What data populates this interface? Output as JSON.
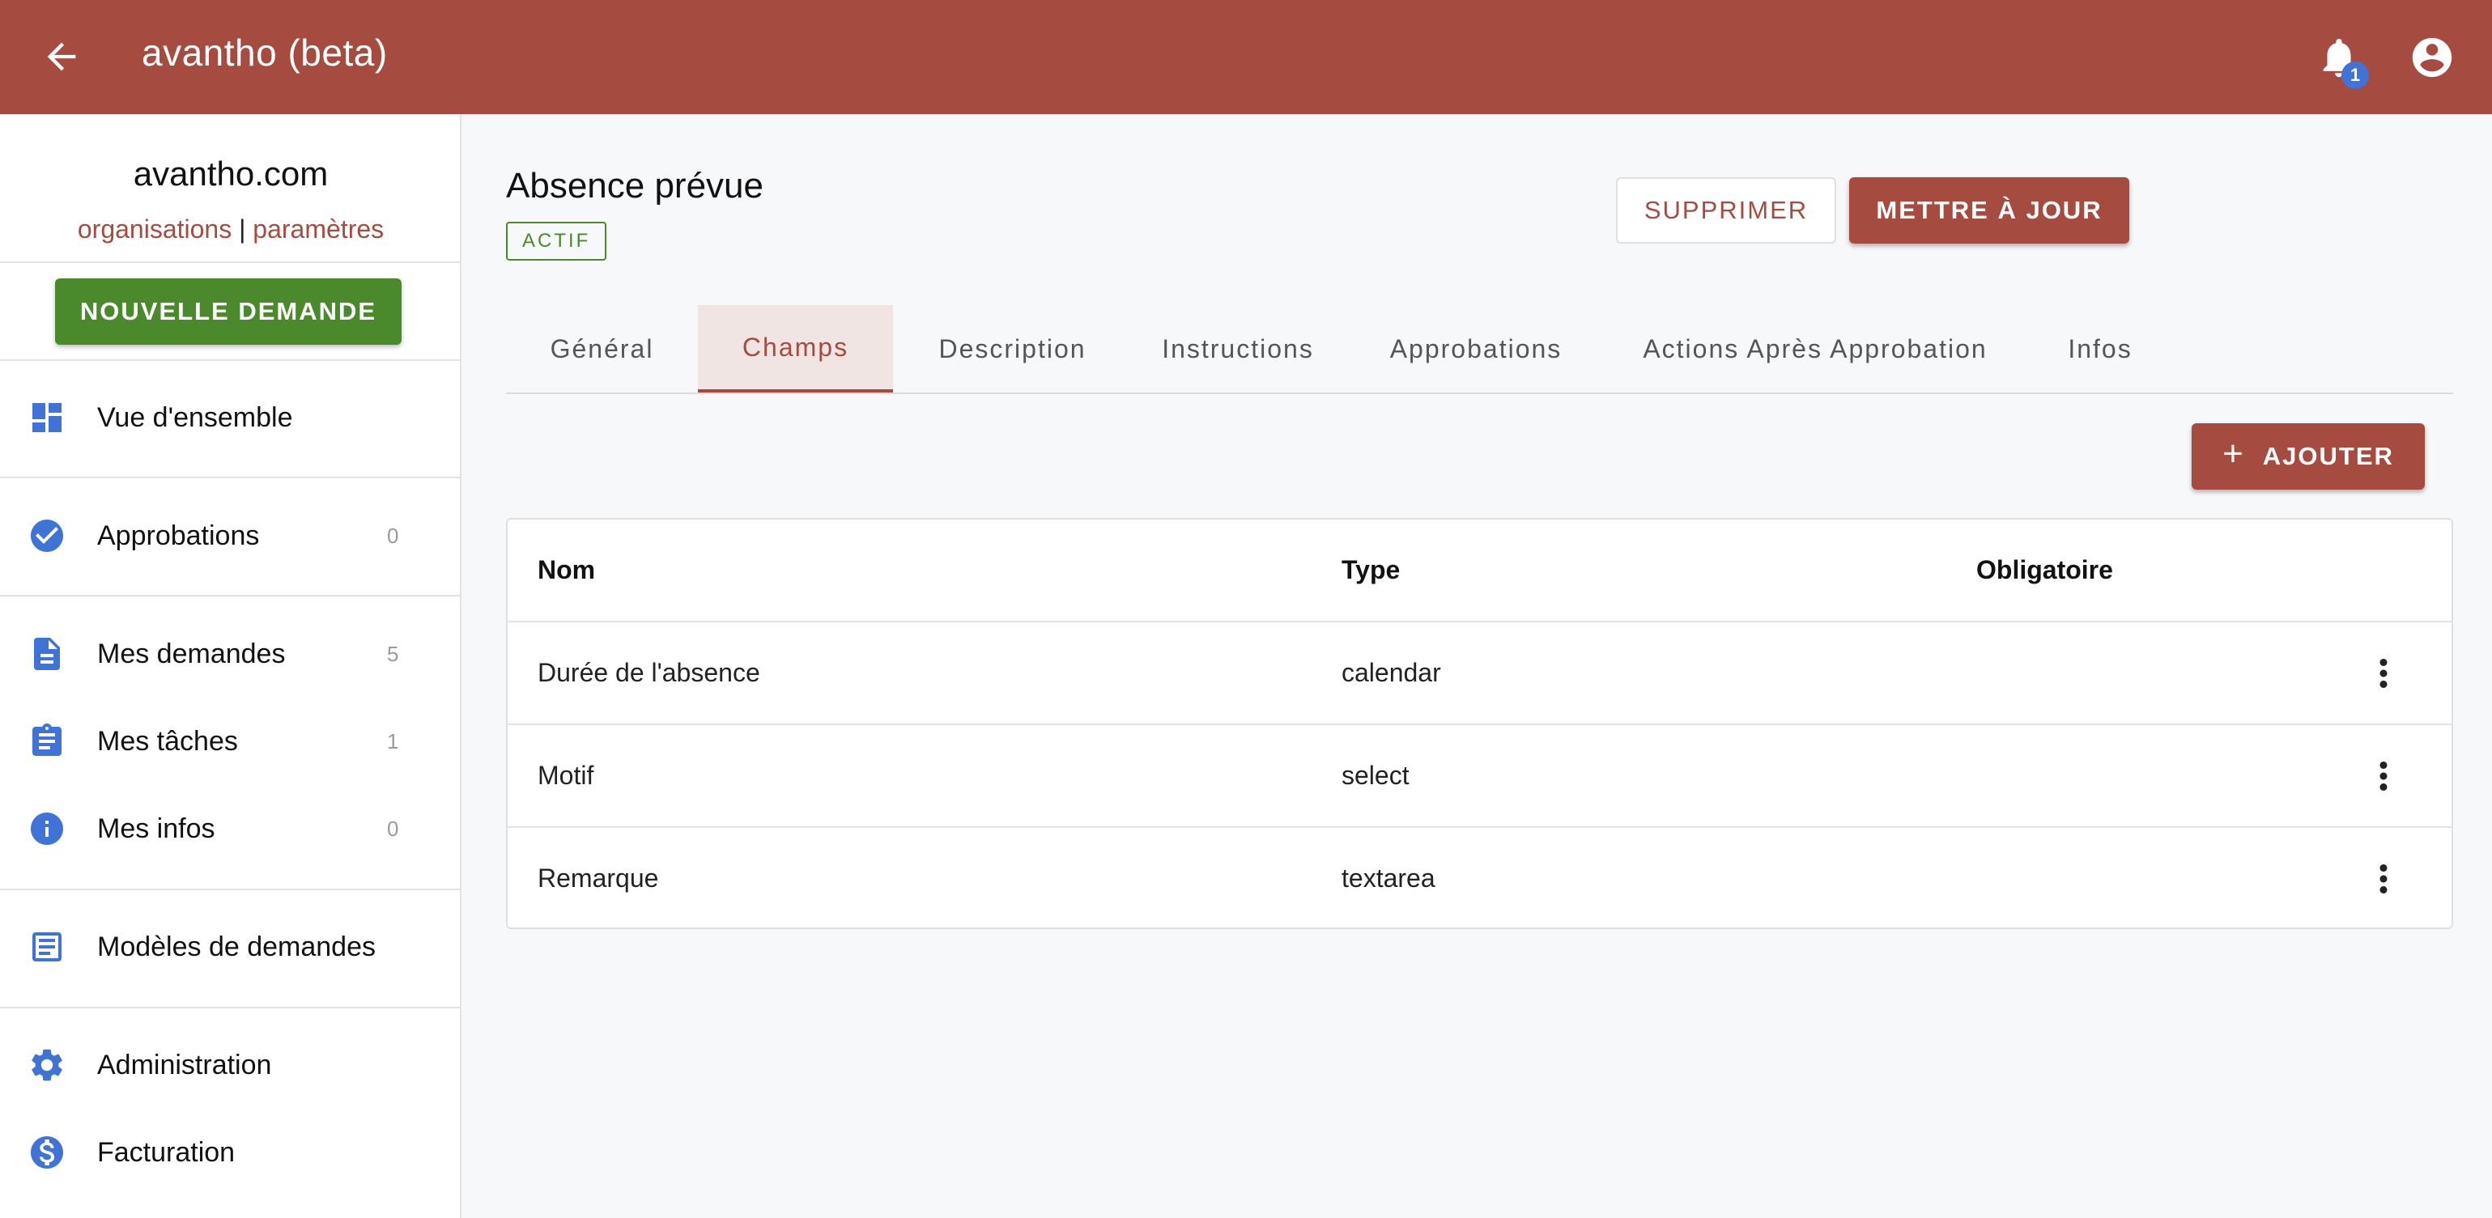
{
  "app": {
    "title": "avantho (beta)",
    "notification_count": "1"
  },
  "sidebar": {
    "org_name": "avantho.com",
    "link_organisations": "organisations",
    "link_separator": "|",
    "link_parametres": "paramètres",
    "new_request_label": "NOUVELLE DEMANDE",
    "items": [
      {
        "label": "Vue d'ensemble",
        "count": "",
        "icon": "dashboard-icon"
      },
      {
        "label": "Approbations",
        "count": "0",
        "icon": "check-circle-icon"
      },
      {
        "label": "Mes demandes",
        "count": "5",
        "icon": "document-icon"
      },
      {
        "label": "Mes tâches",
        "count": "1",
        "icon": "clipboard-icon"
      },
      {
        "label": "Mes infos",
        "count": "0",
        "icon": "info-icon"
      },
      {
        "label": "Modèles de demandes",
        "count": "",
        "icon": "template-icon"
      },
      {
        "label": "Administration",
        "count": "",
        "icon": "gear-icon"
      },
      {
        "label": "Facturation",
        "count": "",
        "icon": "dollar-icon"
      }
    ]
  },
  "main": {
    "title": "Absence prévue",
    "status": "ACTIF",
    "delete_label": "SUPPRIMER",
    "update_label": "METTRE À JOUR",
    "tabs": [
      {
        "label": "Général"
      },
      {
        "label": "Champs"
      },
      {
        "label": "Description"
      },
      {
        "label": "Instructions"
      },
      {
        "label": "Approbations"
      },
      {
        "label": "Actions Après Approbation"
      },
      {
        "label": "Infos"
      }
    ],
    "active_tab": "Champs",
    "add_label": "AJOUTER",
    "table": {
      "headers": [
        "Nom",
        "Type",
        "Obligatoire"
      ],
      "rows": [
        {
          "name": "Durée de l'absence",
          "type": "calendar",
          "required": ""
        },
        {
          "name": "Motif",
          "type": "select",
          "required": ""
        },
        {
          "name": "Remarque",
          "type": "textarea",
          "required": ""
        }
      ]
    }
  },
  "colors": {
    "brand": "#a64b3f",
    "success": "#4a8a2d",
    "icon_blue": "#3f74d6"
  }
}
